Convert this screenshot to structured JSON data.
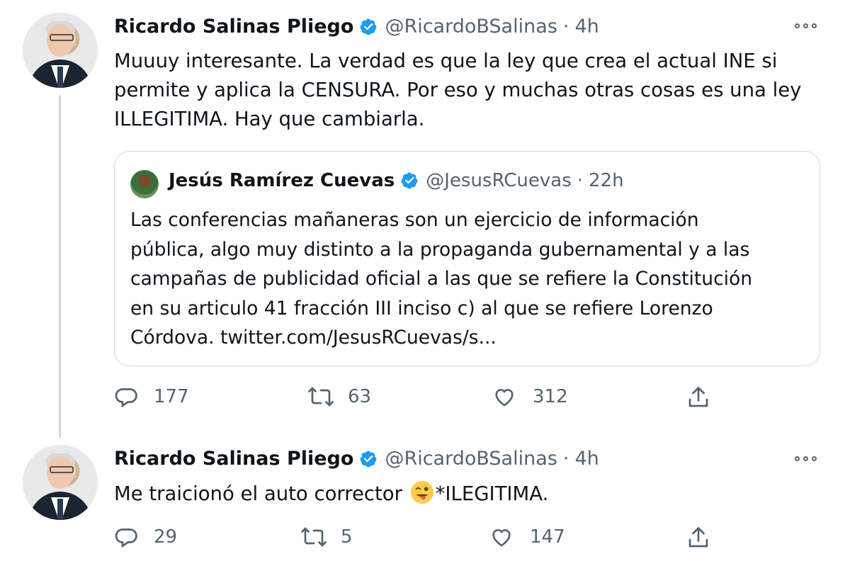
{
  "tweets": [
    {
      "author_name": "Ricardo Salinas Pliego",
      "handle": "@RicardoBSalinas",
      "separator": "·",
      "time": "4h",
      "text": "Muuuy interesante. La verdad es que la ley que crea el actual INE si\npermite y aplica la CENSURA. Por eso y muchas otras cosas es una ley\nILLEGITIMA. Hay que cambiarla.",
      "quote": {
        "author_name": "Jesús Ramírez Cuevas",
        "handle": "@JesusRCuevas",
        "separator": "·",
        "time": "22h",
        "text": "Las conferencias mañaneras son un ejercicio de información\npública, algo muy distinto a la propaganda gubernamental y a las\ncampañas de publicidad oficial a las que se refiere la Constitución\nen su articulo 41 fracción III inciso c) al que se refiere Lorenzo\nCórdova. twitter.com/JesusRCuevas/s..."
      },
      "counts": {
        "replies": "177",
        "retweets": "63",
        "likes": "312"
      }
    },
    {
      "author_name": "Ricardo Salinas Pliego",
      "handle": "@RicardoBSalinas",
      "separator": "·",
      "time": "4h",
      "text_before_emoji": "Me traicionó el auto corrector ",
      "emoji": "winking-face-with-tongue",
      "text_after_emoji": "*ILEGITIMA.",
      "counts": {
        "replies": "29",
        "retweets": "5",
        "likes": "147"
      }
    }
  ],
  "icons": {
    "reply": "reply-icon",
    "retweet": "retweet-icon",
    "like": "heart-icon",
    "share": "share-icon",
    "more": "more-options-icon",
    "verified": "verified-badge-icon"
  },
  "colors": {
    "verified": "#1d9bf0",
    "secondary_text": "#536471",
    "border": "#cfd9de"
  }
}
